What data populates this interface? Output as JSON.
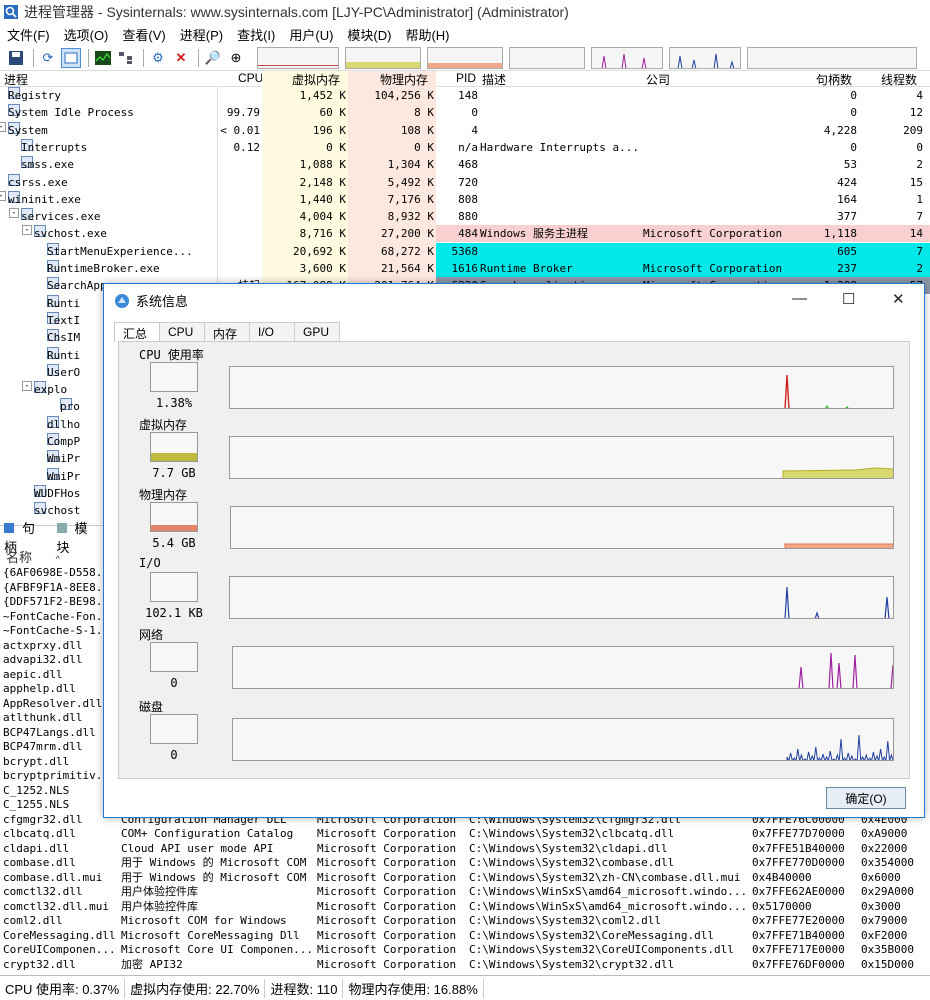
{
  "window": {
    "title": "进程管理器 - Sysinternals: www.sysinternals.com [LJY-PC\\Administrator] (Administrator)"
  },
  "menu": [
    "文件(F)",
    "选项(O)",
    "查看(V)",
    "进程(P)",
    "查找(I)",
    "用户(U)",
    "模块(D)",
    "帮助(H)"
  ],
  "toolbar": {
    "icons": [
      "save-icon",
      "refresh-icon",
      "window-icon",
      "graph-icon",
      "tree-icon",
      "target-icon",
      "kill-icon",
      "search-icon",
      "crosshair-icon"
    ]
  },
  "columns": {
    "process": "进程",
    "cpu": "CPU",
    "virtual": "虚拟内存",
    "physical": "物理内存",
    "pid": "PID",
    "desc": "描述",
    "company": "公司",
    "handles": "句柄数",
    "threads": "线程数"
  },
  "processes": [
    {
      "name": "Registry",
      "cpu": "",
      "vm": "1,452 K",
      "pm": "104,256 K",
      "pid": "148",
      "desc": "",
      "company": "",
      "handles": "0",
      "threads": "4",
      "indent": 1,
      "bg": ""
    },
    {
      "name": "System Idle Process",
      "cpu": "99.79",
      "vm": "60 K",
      "pm": "8 K",
      "pid": "0",
      "desc": "",
      "company": "",
      "handles": "0",
      "threads": "12",
      "indent": 1,
      "bg": ""
    },
    {
      "name": "System",
      "cpu": "< 0.01",
      "vm": "196 K",
      "pm": "108 K",
      "pid": "4",
      "desc": "",
      "company": "",
      "handles": "4,228",
      "threads": "209",
      "indent": 1,
      "bg": "",
      "exp": "-"
    },
    {
      "name": "Interrupts",
      "cpu": "0.12",
      "vm": "0 K",
      "pm": "0 K",
      "pid": "n/a",
      "desc": "Hardware Interrupts a...",
      "company": "",
      "handles": "0",
      "threads": "0",
      "indent": 2,
      "bg": ""
    },
    {
      "name": "smss.exe",
      "cpu": "",
      "vm": "1,088 K",
      "pm": "1,304 K",
      "pid": "468",
      "desc": "",
      "company": "",
      "handles": "53",
      "threads": "2",
      "indent": 2,
      "bg": ""
    },
    {
      "name": "csrss.exe",
      "cpu": "",
      "vm": "2,148 K",
      "pm": "5,492 K",
      "pid": "720",
      "desc": "",
      "company": "",
      "handles": "424",
      "threads": "15",
      "indent": 1,
      "bg": ""
    },
    {
      "name": "wininit.exe",
      "cpu": "",
      "vm": "1,440 K",
      "pm": "7,176 K",
      "pid": "808",
      "desc": "",
      "company": "",
      "handles": "164",
      "threads": "1",
      "indent": 1,
      "bg": "",
      "exp": "-"
    },
    {
      "name": "services.exe",
      "cpu": "",
      "vm": "4,004 K",
      "pm": "8,932 K",
      "pid": "880",
      "desc": "",
      "company": "",
      "handles": "377",
      "threads": "7",
      "indent": 2,
      "bg": "",
      "exp": "-"
    },
    {
      "name": "svchost.exe",
      "cpu": "",
      "vm": "8,716 K",
      "pm": "27,200 K",
      "pid": "484",
      "desc": "Windows 服务主进程",
      "company": "Microsoft Corporation",
      "handles": "1,118",
      "threads": "14",
      "indent": 3,
      "bg": "#f8d0d0",
      "exp": "-"
    },
    {
      "name": "StartMenuExperience...",
      "cpu": "",
      "vm": "20,692 K",
      "pm": "68,272 K",
      "pid": "5368",
      "desc": "",
      "company": "",
      "handles": "605",
      "threads": "7",
      "indent": 4,
      "bg": "#00e8e8"
    },
    {
      "name": "RuntimeBroker.exe",
      "cpu": "",
      "vm": "3,600 K",
      "pm": "21,564 K",
      "pid": "1616",
      "desc": "Runtime Broker",
      "company": "Microsoft Corporation",
      "handles": "237",
      "threads": "2",
      "indent": 4,
      "bg": "#00e8e8"
    },
    {
      "name": "SearchApp.exe",
      "cpu": "挂起",
      "vm": "167,088 K",
      "pm": "201,764 K",
      "pid": "6220",
      "desc": "Search application",
      "company": "Microsoft Corporation",
      "handles": "1,298",
      "threads": "57",
      "indent": 4,
      "bg": "#8c9aa8"
    },
    {
      "name": "Runti",
      "indent": 4,
      "bg": "#00e8e8"
    },
    {
      "name": "TextI",
      "indent": 4,
      "bg": "#00e8e8"
    },
    {
      "name": "ChsIM",
      "indent": 4,
      "bg": "#c8c8f0"
    },
    {
      "name": "Runti",
      "indent": 4,
      "bg": "#c8c8f0"
    },
    {
      "name": "UserO",
      "indent": 4,
      "bg": "#c8c8f0"
    },
    {
      "name": "explo",
      "indent": 3,
      "bg": "#c8c8f0",
      "exp": "-"
    },
    {
      "name": "pro",
      "indent": 5,
      "bg": "#c8c8f0"
    },
    {
      "name": "dllho",
      "indent": 4,
      "bg": "#c8c8f0"
    },
    {
      "name": "CompP",
      "indent": 4,
      "bg": "#c8c8f0"
    },
    {
      "name": "WmiPr",
      "indent": 4,
      "bg": ""
    },
    {
      "name": "WmiPr",
      "indent": 4,
      "bg": ""
    },
    {
      "name": "WUDFHos",
      "indent": 3,
      "bg": ""
    },
    {
      "name": "svchost",
      "indent": 3,
      "bg": "#f8d0d0"
    }
  ],
  "lower_tabs": [
    "句柄",
    "模块"
  ],
  "lower_header": "名称",
  "dlls": [
    {
      "name": "{6AF0698E-D558...",
      "desc": "",
      "company": "",
      "path": "",
      "base": "",
      "size": ""
    },
    {
      "name": "{AFBF9F1A-8EE8...",
      "desc": "",
      "company": "",
      "path": "",
      "base": "",
      "size": ""
    },
    {
      "name": "{DDF571F2-BE98...",
      "desc": "",
      "company": "",
      "path": "",
      "base": "",
      "size": ""
    },
    {
      "name": "~FontCache-Fon...",
      "desc": "",
      "company": "",
      "path": "",
      "base": "",
      "size": ""
    },
    {
      "name": "~FontCache-S-1...",
      "desc": "",
      "company": "",
      "path": "",
      "base": "",
      "size": ""
    },
    {
      "name": "actxprxy.dll",
      "desc": "",
      "company": "",
      "path": "",
      "base": "",
      "size": ""
    },
    {
      "name": "advapi32.dll",
      "desc": "",
      "company": "",
      "path": "",
      "base": "",
      "size": ""
    },
    {
      "name": "aepic.dll",
      "desc": "",
      "company": "",
      "path": "",
      "base": "",
      "size": ""
    },
    {
      "name": "apphelp.dll",
      "desc": "",
      "company": "",
      "path": "",
      "base": "",
      "size": ""
    },
    {
      "name": "AppResolver.dll",
      "desc": "",
      "company": "",
      "path": "",
      "base": "",
      "size": ""
    },
    {
      "name": "atlthunk.dll",
      "desc": "",
      "company": "",
      "path": "",
      "base": "",
      "size": ""
    },
    {
      "name": "BCP47Langs.dll",
      "desc": "",
      "company": "",
      "path": "",
      "base": "",
      "size": ""
    },
    {
      "name": "BCP47mrm.dll",
      "desc": "",
      "company": "",
      "path": "",
      "base": "",
      "size": ""
    },
    {
      "name": "bcrypt.dll",
      "desc": "",
      "company": "",
      "path": "",
      "base": "",
      "size": ""
    },
    {
      "name": "bcryptprimitiv...",
      "desc": "",
      "company": "",
      "path": "",
      "base": "",
      "size": ""
    },
    {
      "name": "C_1252.NLS",
      "desc": "",
      "company": "",
      "path": "",
      "base": "",
      "size": ""
    },
    {
      "name": "C_1255.NLS",
      "desc": "",
      "company": "",
      "path": "",
      "base": "",
      "size": ""
    },
    {
      "name": "cfgmgr32.dll",
      "desc": "Configuration Manager DLL",
      "company": "Microsoft Corporation",
      "path": "C:\\Windows\\System32\\cfgmgr32.dll",
      "base": "0x7FFE76C00000",
      "size": "0x4E000"
    },
    {
      "name": "clbcatq.dll",
      "desc": "COM+ Configuration Catalog",
      "company": "Microsoft Corporation",
      "path": "C:\\Windows\\System32\\clbcatq.dll",
      "base": "0x7FFE77D70000",
      "size": "0xA9000"
    },
    {
      "name": "cldapi.dll",
      "desc": "Cloud API user mode API",
      "company": "Microsoft Corporation",
      "path": "C:\\Windows\\System32\\cldapi.dll",
      "base": "0x7FFE51B40000",
      "size": "0x22000"
    },
    {
      "name": "combase.dll",
      "desc": "用于 Windows 的 Microsoft COM",
      "company": "Microsoft Corporation",
      "path": "C:\\Windows\\System32\\combase.dll",
      "base": "0x7FFE770D0000",
      "size": "0x354000"
    },
    {
      "name": "combase.dll.mui",
      "desc": "用于 Windows 的 Microsoft COM",
      "company": "Microsoft Corporation",
      "path": "C:\\Windows\\System32\\zh-CN\\combase.dll.mui",
      "base": "0x4B40000",
      "size": "0x6000"
    },
    {
      "name": "comctl32.dll",
      "desc": "用户体验控件库",
      "company": "Microsoft Corporation",
      "path": "C:\\Windows\\WinSxS\\amd64_microsoft.windo...",
      "base": "0x7FFE62AE0000",
      "size": "0x29A000"
    },
    {
      "name": "comctl32.dll.mui",
      "desc": "用户体验控件库",
      "company": "Microsoft Corporation",
      "path": "C:\\Windows\\WinSxS\\amd64_microsoft.windo...",
      "base": "0x5170000",
      "size": "0x3000"
    },
    {
      "name": "coml2.dll",
      "desc": "Microsoft COM for Windows",
      "company": "Microsoft Corporation",
      "path": "C:\\Windows\\System32\\coml2.dll",
      "base": "0x7FFE77E20000",
      "size": "0x79000"
    },
    {
      "name": "CoreMessaging.dll",
      "desc": "Microsoft CoreMessaging Dll",
      "company": "Microsoft Corporation",
      "path": "C:\\Windows\\System32\\CoreMessaging.dll",
      "base": "0x7FFE71B40000",
      "size": "0xF2000"
    },
    {
      "name": "CoreUIComponen...",
      "desc": "Microsoft Core UI Componen...",
      "company": "Microsoft Corporation",
      "path": "C:\\Windows\\System32\\CoreUIComponents.dll",
      "base": "0x7FFE717E0000",
      "size": "0x35B000"
    },
    {
      "name": "crypt32.dll",
      "desc": "加密 API32",
      "company": "Microsoft Corporation",
      "path": "C:\\Windows\\System32\\crypt32.dll",
      "base": "0x7FFE76DF0000",
      "size": "0x15D000"
    }
  ],
  "status": {
    "cpu": "CPU 使用率: 0.37%",
    "vm": "虚拟内存使用: 22.70%",
    "procs": "进程数: 110",
    "pm": "物理内存使用: 16.88%"
  },
  "dialog": {
    "title": "系统信息",
    "tabs": [
      "汇总",
      "CPU",
      "内存",
      "I/O",
      "GPU"
    ],
    "sections": [
      {
        "label": "CPU 使用率",
        "value": "1.38%",
        "color": "#d02020",
        "level": 0.01
      },
      {
        "label": "虚拟内存",
        "value": "7.7 GB",
        "color": "#b0b020",
        "level": 0.23
      },
      {
        "label": "物理内存",
        "value": "5.4 GB",
        "color": "#e07050",
        "level": 0.17
      },
      {
        "label": "I/O",
        "value": "102.1  KB",
        "color": "#2040a0",
        "level": 0
      },
      {
        "label": "网络",
        "value": "0",
        "color": "#a020a0",
        "level": 0
      },
      {
        "label": "磁盘",
        "value": "0",
        "color": "#2040a0",
        "level": 0
      }
    ],
    "ok": "确定(O)"
  }
}
